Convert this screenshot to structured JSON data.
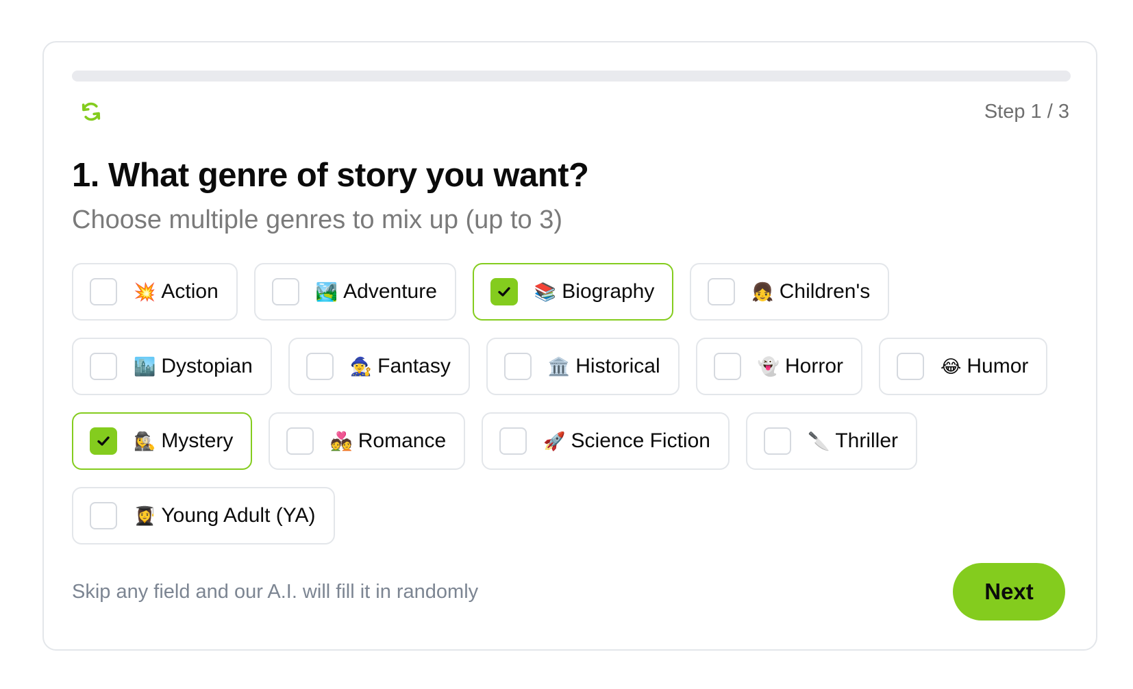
{
  "progress": {
    "percent": 0
  },
  "header": {
    "step_label": "Step 1 / 3",
    "refresh_icon": "refresh-icon"
  },
  "question": {
    "title": "1. What genre of story you want?",
    "subtitle": "Choose multiple genres to mix up (up to 3)"
  },
  "options": [
    [
      {
        "emoji": "💥",
        "label": "Action",
        "selected": false
      },
      {
        "emoji": "🏞️",
        "label": "Adventure",
        "selected": false
      },
      {
        "emoji": "📚",
        "label": "Biography",
        "selected": true
      },
      {
        "emoji": "👧",
        "label": "Children's",
        "selected": false
      }
    ],
    [
      {
        "emoji": "🏙️",
        "label": "Dystopian",
        "selected": false
      },
      {
        "emoji": "🧙‍♀️",
        "label": "Fantasy",
        "selected": false
      },
      {
        "emoji": "🏛️",
        "label": "Historical",
        "selected": false
      },
      {
        "emoji": "👻",
        "label": "Horror",
        "selected": false
      },
      {
        "emoji": "😂",
        "label": "Humor",
        "selected": false
      }
    ],
    [
      {
        "emoji": "🕵️‍♀️",
        "label": "Mystery",
        "selected": true
      },
      {
        "emoji": "💑",
        "label": "Romance",
        "selected": false
      },
      {
        "emoji": "🚀",
        "label": "Science Fiction",
        "selected": false
      },
      {
        "emoji": "🔪",
        "label": "Thriller",
        "selected": false
      }
    ],
    [
      {
        "emoji": "👩‍🎓",
        "label": "Young Adult (YA)",
        "selected": false
      }
    ]
  ],
  "footer": {
    "note": "Skip any field and our A.I. will fill it in randomly",
    "next_label": "Next"
  },
  "colors": {
    "accent": "#84cc1e",
    "border": "#e3e6ea",
    "track": "#e9eaee"
  }
}
